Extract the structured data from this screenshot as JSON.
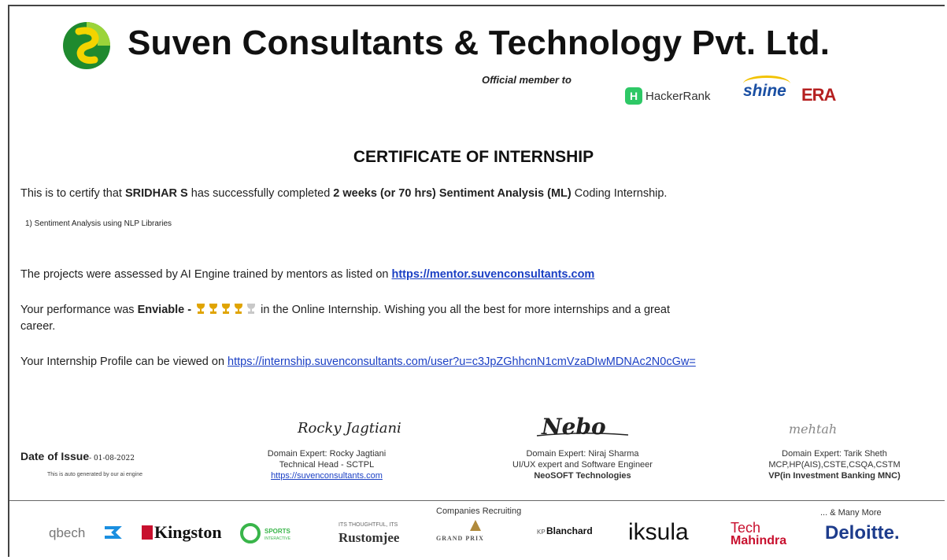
{
  "header": {
    "company": "Suven Consultants & Technology Pvt. Ltd.",
    "official_member": "Official member to",
    "partners": {
      "hackerrank_icon_letter": "H",
      "hackerrank": "HackerRank",
      "shine": "shine",
      "era": "ERA"
    }
  },
  "certificate": {
    "title": "CERTIFICATE OF INTERNSHIP",
    "line1_pre": "This is to certify that ",
    "name": "SRIDHAR S",
    "line1_mid": " has successfully completed ",
    "duration": "2 weeks (or 70 hrs) Sentiment Analysis (ML)",
    "line1_post": " Coding Internship.",
    "project": "1) Sentiment Analysis using NLP Libraries",
    "assessed_pre": "The projects were assessed by AI Engine trained by mentors as listed on ",
    "mentor_link": "https://mentor.suvenconsultants.com",
    "perf_pre": "Your performance was ",
    "perf_rating": "Enviable",
    "perf_dash": " - ",
    "perf_post": " in the Online Internship. Wishing you all the best for more internships and a great",
    "perf_post2": "career.",
    "trophies_earned": 4,
    "trophies_total": 5,
    "profile_pre": "Your Internship Profile can be viewed on ",
    "profile_link": "https://internship.suvenconsultants.com/user?u=c3JpZGhhcnN1cmVzaDIwMDNAc2N0cGw="
  },
  "signatures": {
    "date_label": "Date of Issue",
    "date_value": "01-08-2022",
    "auto_note": "This is auto generated by our ai engine",
    "sig1": {
      "signature": "Rocky Jagtiani",
      "line1": "Domain Expert: Rocky Jagtiani",
      "line2": "Technical Head - SCTPL",
      "link": "https://suvenconsultants.com"
    },
    "sig2": {
      "signature": "Nebo",
      "line1": "Domain Expert: Niraj Sharma",
      "line2": "UI/UX expert and Software Engineer",
      "line3": "NeoSOFT Technologies"
    },
    "sig3": {
      "signature": "mehtah",
      "line1": "Domain Expert: Tarik Sheth",
      "line2": "MCP,HP(AIS),CSTE,CSQA,CSTM",
      "line3": "VP(in Investment Banking MNC)"
    }
  },
  "footer": {
    "recruiting_label": "Companies Recruiting",
    "many_more": "... & Many More",
    "brands": [
      "qbech",
      "Kingston",
      "SPORTS",
      "Rustomjee",
      "GRAND PRIX",
      "Blanchard",
      "iksula",
      "Tech Mahindra",
      "Deloitte."
    ],
    "rustomjee_tag": "ITS THOUGHTFUL, ITS",
    "sports_sub": "INTERACTIVE",
    "tech": "Tech",
    "mahindra": "Mahindra",
    "kp": "KP"
  }
}
